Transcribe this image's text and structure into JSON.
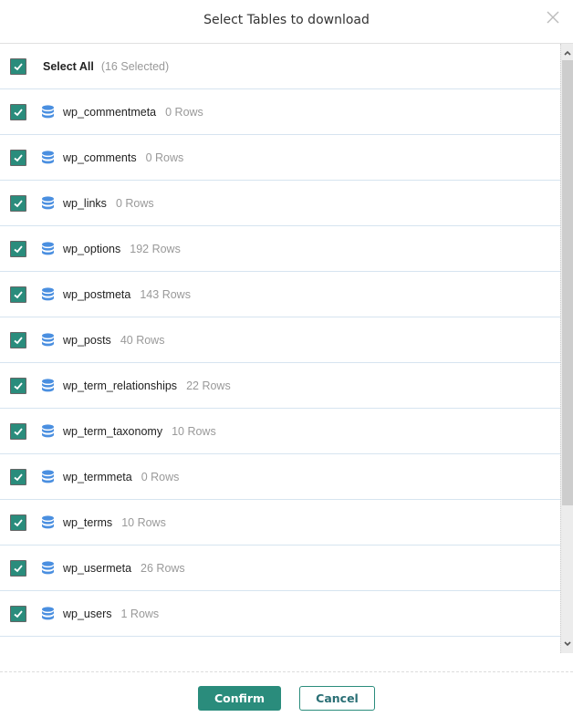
{
  "dialog": {
    "title": "Select Tables to download",
    "close_icon": "close-icon"
  },
  "select_all": {
    "label": "Select All",
    "selected_text": "(16 Selected)",
    "checked": true
  },
  "tables": [
    {
      "name": "wp_commentmeta",
      "rows": "0 Rows",
      "checked": true
    },
    {
      "name": "wp_comments",
      "rows": "0 Rows",
      "checked": true
    },
    {
      "name": "wp_links",
      "rows": "0 Rows",
      "checked": true
    },
    {
      "name": "wp_options",
      "rows": "192 Rows",
      "checked": true
    },
    {
      "name": "wp_postmeta",
      "rows": "143 Rows",
      "checked": true
    },
    {
      "name": "wp_posts",
      "rows": "40 Rows",
      "checked": true
    },
    {
      "name": "wp_term_relationships",
      "rows": "22 Rows",
      "checked": true
    },
    {
      "name": "wp_term_taxonomy",
      "rows": "10 Rows",
      "checked": true
    },
    {
      "name": "wp_termmeta",
      "rows": "0 Rows",
      "checked": true
    },
    {
      "name": "wp_terms",
      "rows": "10 Rows",
      "checked": true
    },
    {
      "name": "wp_usermeta",
      "rows": "26 Rows",
      "checked": true
    },
    {
      "name": "wp_users",
      "rows": "1 Rows",
      "checked": true
    }
  ],
  "footer": {
    "confirm_label": "Confirm",
    "cancel_label": "Cancel"
  },
  "colors": {
    "accent": "#2a8c7c",
    "db_icon": "#4a8fe0"
  }
}
